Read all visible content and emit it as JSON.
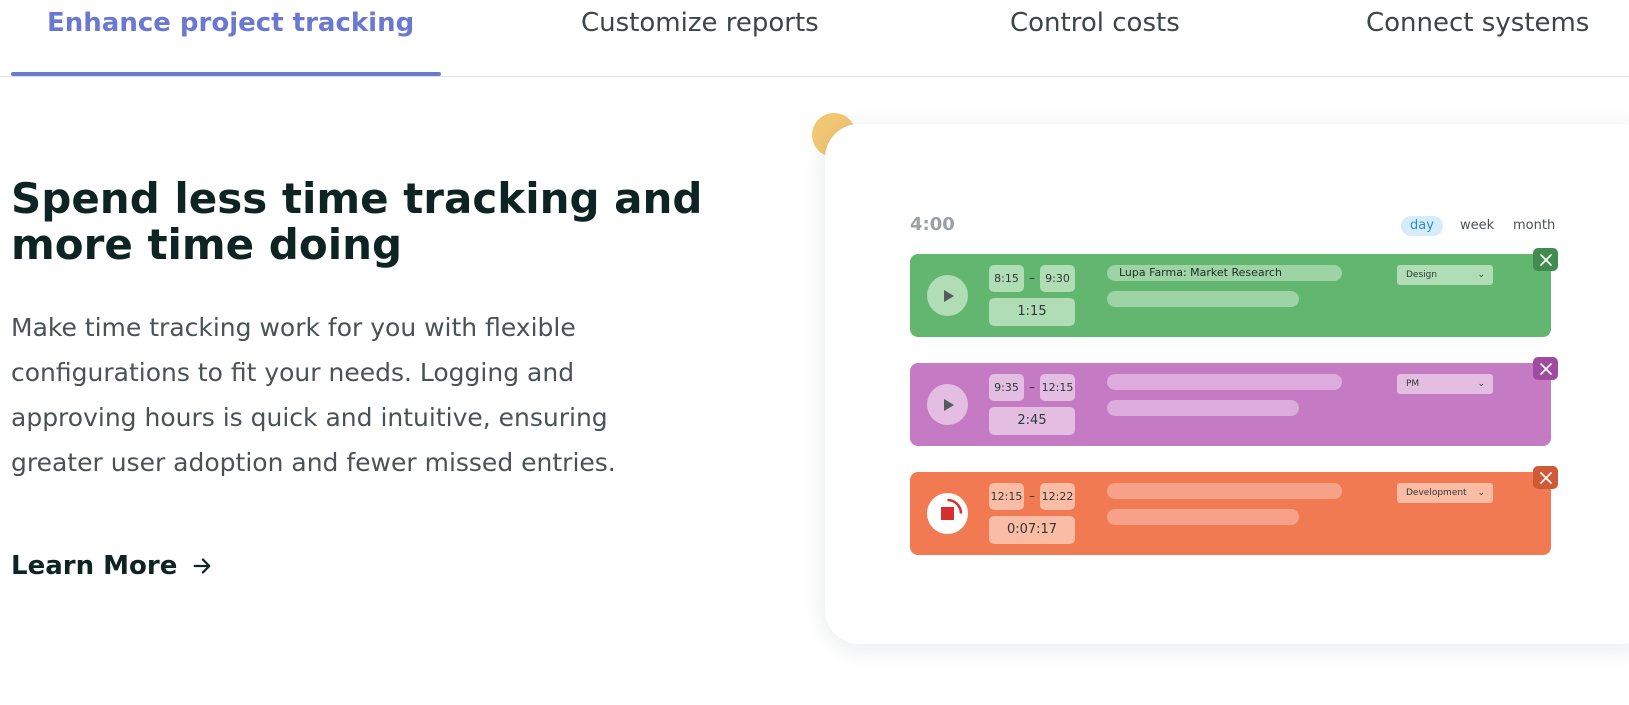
{
  "tabs": {
    "items": [
      {
        "label": "Enhance project tracking",
        "active": true
      },
      {
        "label": "Customize reports",
        "active": false
      },
      {
        "label": "Control costs",
        "active": false
      },
      {
        "label": "Connect systems",
        "active": false
      }
    ]
  },
  "hero": {
    "headline": "Spend less time tracking and more time doing",
    "body": "Make time tracking work for you with flexible configurations to fit your needs. Logging and approving hours is quick and intuitive, ensuring greater user adoption and fewer missed entries.",
    "cta_label": "Learn More"
  },
  "tracker": {
    "total": "4:00",
    "periods": {
      "day": "day",
      "week": "week",
      "month": "month",
      "active": "day"
    },
    "entries": [
      {
        "start": "8:15",
        "end": "9:30",
        "duration": "1:15",
        "project": "Lupa Farma: Market Research",
        "tag": "Design",
        "state": "stopped"
      },
      {
        "start": "9:35",
        "end": "12:15",
        "duration": "2:45",
        "project": "",
        "tag": "PM",
        "state": "stopped"
      },
      {
        "start": "12:15",
        "end": "12:22",
        "duration": "0:07:17",
        "project": "",
        "tag": "Development",
        "state": "running"
      }
    ]
  },
  "colors": {
    "accent": "#6b78d1",
    "entry_design": "#62b670",
    "entry_pm": "#c47bc3",
    "entry_development": "#f27a53",
    "decor": "#f2c774"
  },
  "icons": {
    "cta": "arrow-right-icon",
    "play": "play-icon",
    "stop": "stop-icon",
    "close": "close-icon",
    "dropdown": "chevron-down-icon"
  }
}
